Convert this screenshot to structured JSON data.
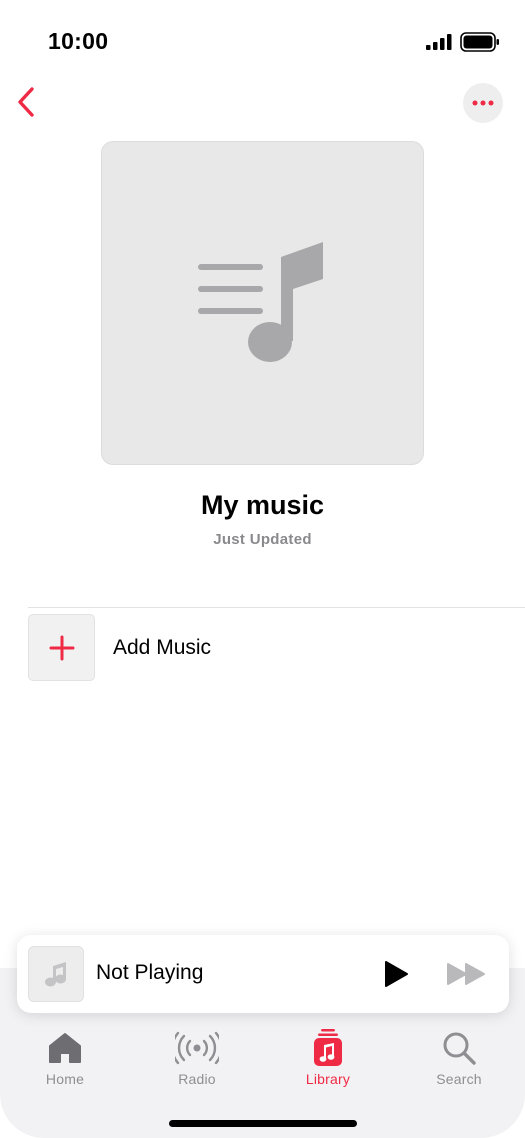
{
  "status_bar": {
    "time": "10:00",
    "signal_icon": "cellular-signal-icon",
    "battery_icon": "battery-full-icon"
  },
  "navigation": {
    "back_icon": "chevron-left-icon",
    "more_icon": "ellipsis-icon"
  },
  "playlist": {
    "artwork_icon": "playlist-music-icon",
    "title": "My music",
    "subtitle": "Just Updated"
  },
  "add_music": {
    "icon": "plus-icon",
    "label": "Add Music"
  },
  "mini_player": {
    "artwork_icon": "music-note-icon",
    "title": "Not Playing",
    "play_icon": "play-icon",
    "forward_icon": "fast-forward-icon"
  },
  "tabs": [
    {
      "label": "Home",
      "icon": "house-icon",
      "active": false
    },
    {
      "label": "Radio",
      "icon": "radio-broadcast-icon",
      "active": false
    },
    {
      "label": "Library",
      "icon": "library-icon",
      "active": true
    },
    {
      "label": "Search",
      "icon": "magnifying-glass-icon",
      "active": false
    }
  ],
  "colors": {
    "accent": "#EF2A45",
    "inactive_tab": "#8E8E93",
    "artwork_background": "#E8E8E8",
    "tab_bar_background": "#F2F2F4"
  }
}
